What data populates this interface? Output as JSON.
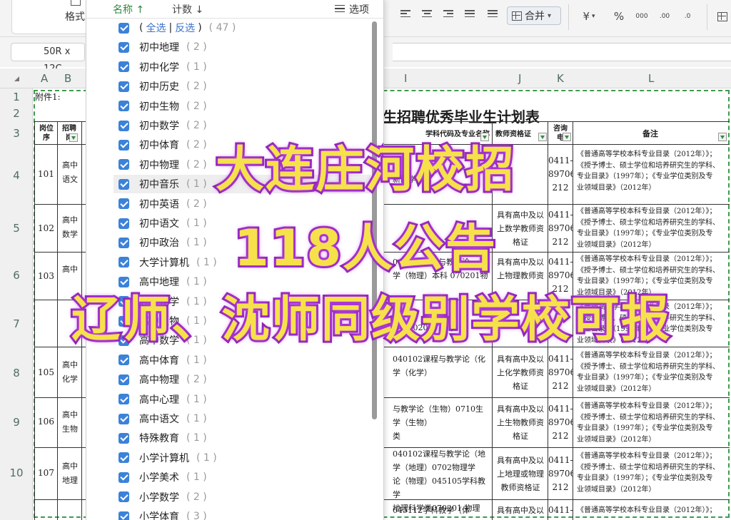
{
  "toolbar": {
    "format_label": "格式",
    "merge_label": "合并",
    "currency_symbol": "¥",
    "percent_symbol": "%",
    "thousands_symbol": "000",
    "dec_increase": ".00",
    "dec_decrease": ".0"
  },
  "formula_bar": {
    "name_box": "50R x 12C"
  },
  "columns": {
    "A": "A",
    "B": "B",
    "I": "I",
    "J": "J",
    "K": "K",
    "L": "L"
  },
  "rows": [
    "1",
    "2",
    "3",
    "4",
    "5",
    "6",
    "7",
    "8",
    "9",
    "10"
  ],
  "filter_panel": {
    "sort_name": "名称",
    "sort_count": "计数",
    "options": "选项",
    "select_all": "全选",
    "invert": "反选",
    "total": "47",
    "items": [
      {
        "name": "初中地理",
        "count": "2"
      },
      {
        "name": "初中化学",
        "count": "1"
      },
      {
        "name": "初中历史",
        "count": "2"
      },
      {
        "name": "初中生物",
        "count": "2"
      },
      {
        "name": "初中数学",
        "count": "2"
      },
      {
        "name": "初中体育",
        "count": "2"
      },
      {
        "name": "初中物理",
        "count": "2"
      },
      {
        "name": "初中音乐",
        "count": "1"
      },
      {
        "name": "初中英语",
        "count": "2"
      },
      {
        "name": "初中语文",
        "count": "1"
      },
      {
        "name": "初中政治",
        "count": "1"
      },
      {
        "name": "大学计算机",
        "count": "1"
      },
      {
        "name": "高中地理",
        "count": "1"
      },
      {
        "name": "高中化学",
        "count": "1"
      },
      {
        "name": "高中生物",
        "count": "1"
      },
      {
        "name": "高中数学",
        "count": "1"
      },
      {
        "name": "高中体育",
        "count": "1"
      },
      {
        "name": "高中物理",
        "count": "2"
      },
      {
        "name": "高中心理",
        "count": "1"
      },
      {
        "name": "高中语文",
        "count": "1"
      },
      {
        "name": "特殊教育",
        "count": "1"
      },
      {
        "name": "小学计算机",
        "count": "1"
      },
      {
        "name": "小学美术",
        "count": "1"
      },
      {
        "name": "小学数学",
        "count": "2"
      },
      {
        "name": "小学体育",
        "count": "3"
      }
    ]
  },
  "sheet": {
    "attachment": "附件1:",
    "title": "生招聘优秀毕业生计划表",
    "headers": {
      "post_id": "岗位序",
      "post": "招聘岗",
      "major": "学科代码及专业名称",
      "cert": "教师资格证",
      "phone": "咨询电",
      "remark": "备注"
    },
    "phone_lines": [
      "0411-",
      "89706",
      "212"
    ],
    "remark_lines": [
      "《普通高等学校本科专业目录（2012年）》；",
      "《授予博士、硕士学位和培养研究生的学科、",
      "专业目录》（1997年）；《专业学位类别及专",
      "业领域目录》（2012年）"
    ],
    "records": [
      {
        "id": "101",
        "post": [
          "高中",
          "语文"
        ],
        "major": [
          "",
          "",
          "新闻学"
        ],
        "cert": [
          "",
          "",
          ""
        ]
      },
      {
        "id": "102",
        "post": [
          "高中",
          "数学"
        ],
        "major": [
          "",
          "",
          ""
        ],
        "cert": [
          "具有高中及以",
          "上数学教师资",
          "格证"
        ]
      },
      {
        "id": "103",
        "post": [
          "高中",
          ""
        ],
        "major": [
          "040102课程与教学论",
          "学（物理）本科 070201物",
          ""
        ],
        "cert": [
          "具有高中及以",
          "上物理教师资",
          ""
        ]
      },
      {
        "id": "",
        "post": [
          "",
          ""
        ],
        "major": [
          "",
          "学  070204T 声学",
          ""
        ],
        "cert": [
          "",
          "",
          ""
        ]
      },
      {
        "id": "105",
        "post": [
          "高中",
          "化学"
        ],
        "major": [
          "040102课程与教学论（化",
          "学（化学）",
          ""
        ],
        "cert": [
          "具有高中及以",
          "上化学教师资",
          "格证"
        ]
      },
      {
        "id": "106",
        "post": [
          "高中",
          "生物"
        ],
        "major": [
          "与教学论（生物）0710生",
          "学（生物）",
          "类"
        ],
        "cert": [
          "具有高中及以",
          "上生物教师资",
          "格证"
        ]
      },
      {
        "id": "107",
        "post": [
          "高中",
          "地理"
        ],
        "major": [
          "040102课程与教学论（地",
          "学（地理）0702物理学",
          "论（物理）045105学科教学",
          "地理科学类070201  物理"
        ],
        "cert": [
          "具有高中及以",
          "上地理或物理",
          "教师资格证"
        ]
      },
      {
        "id": "",
        "post": [
          "",
          ""
        ],
        "major": [
          "045112学科教学（体",
          "",
          ""
        ],
        "cert": [
          "具有高中及以",
          "",
          ""
        ]
      }
    ]
  },
  "overlay": {
    "line1": "大连庄河校招",
    "line2": "118人公告",
    "line3": "辽师、沈师同级别学校可报"
  },
  "colors": {
    "accent_green": "#2f8b3f",
    "checkbox_blue": "#3b82d9",
    "overlay_fill": "#f6e14a",
    "overlay_stroke": "#8a1fb4"
  }
}
